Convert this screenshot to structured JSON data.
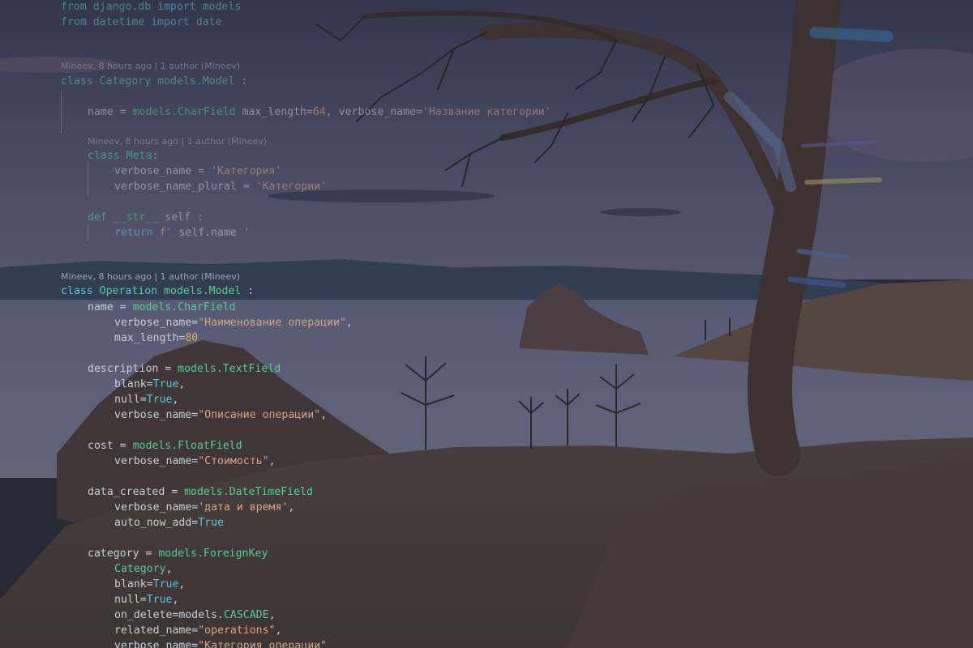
{
  "colors": {
    "keyword": "#5ac4d8",
    "class": "#56c9a8",
    "function": "#4fd08f",
    "number": "#e0b065",
    "string": "#d3a684",
    "text": "#c8cdd6",
    "blame": "#9ea3b5"
  },
  "background": "lake-landscape-with-tree",
  "blame_annotations": {
    "category_class": "Mineev, 8 hours ago | 1 author (Mineev)",
    "meta_class": "Mineev, 8 hours ago | 1 author (Mineev)",
    "operation_class": "Mineev, 8 hours ago | 1 author (Mineev)"
  },
  "code": {
    "l1": {
      "kw": "from",
      "mod": "django.db",
      "kw2": "import",
      "name": "models"
    },
    "l2": {
      "kw": "from",
      "mod": "datetime",
      "kw2": "import",
      "name": "date"
    },
    "l3": {
      "kw": "class",
      "name": "Category",
      "base_mod": "models.",
      "base": "Model",
      "colon": " :"
    },
    "l4": {
      "name": "name = ",
      "mod": "models.",
      "fn": "CharField",
      "arg1": " max_length=",
      "num": "64",
      "arg2": ", verbose_name=",
      "str": "'Название категории'"
    },
    "l5": {
      "kw": "class",
      "name": "Meta",
      "colon": ":"
    },
    "l6": {
      "name": "verbose_name = ",
      "str": "'Категория'"
    },
    "l7": {
      "name": "verbose_name_plural = ",
      "str": "'Категории'"
    },
    "l8": {
      "kw": "def",
      "name": " __str__ ",
      "arg": "self :"
    },
    "l9": {
      "kw": "return",
      "f": " f'",
      "arg": " self.name ",
      "end": "'"
    },
    "l10": {
      "kw": "class",
      "name": "Operation",
      "base_mod": "models.",
      "base": "Model",
      "colon": " :"
    },
    "l11": {
      "name": "name = ",
      "mod": "models.",
      "fn": "CharField"
    },
    "l12": {
      "name": "verbose_name=",
      "str": "\"Наименование операции\"",
      "end": ","
    },
    "l13": {
      "name": "max_length=",
      "num": "80"
    },
    "l14": {
      "name": "description = ",
      "mod": "models.",
      "fn": "TextField"
    },
    "l15": {
      "name": "blank=",
      "bool": "True",
      "end": ","
    },
    "l16": {
      "name": "null=",
      "bool": "True",
      "end": ","
    },
    "l17": {
      "name": "verbose_name=",
      "str": "\"Описание операции\"",
      "end": ","
    },
    "l18": {
      "name": "cost = ",
      "mod": "models.",
      "fn": "FloatField"
    },
    "l19": {
      "name": "verbose_name=",
      "str": "\"Стоимость\"",
      "end": ","
    },
    "l20": {
      "name": "data_created = ",
      "mod": "models.",
      "fn": "DateTimeField"
    },
    "l21": {
      "name": "verbose_name=",
      "str": "'дата и время'",
      "end": ","
    },
    "l22": {
      "name": "auto_now_add=",
      "bool": "True"
    },
    "l23": {
      "name": "category = ",
      "mod": "models.",
      "fn": "ForeignKey"
    },
    "l24": {
      "cls": "Category",
      "end": ","
    },
    "l25": {
      "name": "blank=",
      "bool": "True",
      "end": ","
    },
    "l26": {
      "name": "null=",
      "bool": "True",
      "end": ","
    },
    "l27": {
      "name": "on_delete=",
      "mod": "models.",
      "cls": "CASCADE",
      "end": ","
    },
    "l28": {
      "name": "related_name=",
      "str": "\"operations\"",
      "end": ","
    },
    "l29": {
      "name": "verbose_name=",
      "str": "\"Категория операции\""
    }
  }
}
